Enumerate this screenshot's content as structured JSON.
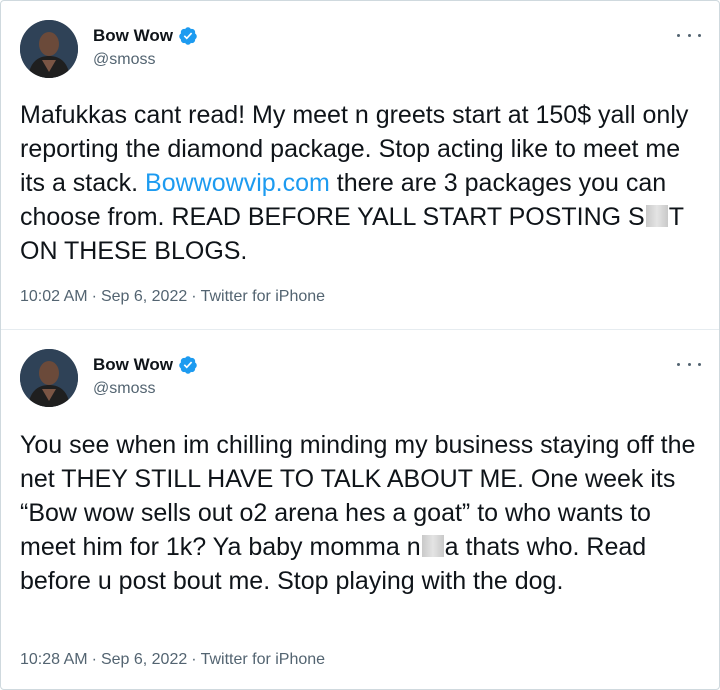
{
  "tweets": [
    {
      "author": {
        "name": "Bow Wow",
        "handle": "@smoss",
        "verified": true
      },
      "text": {
        "part1": "Mafukkas cant read! My meet n greets start at 150$ yall only reporting the diamond package. Stop acting like to meet me its a stack. ",
        "link": "Bowwowvip.com",
        "part2": " there are 3 packages you can choose from. READ BEFORE YALL START POSTING S",
        "part3": "T ON THESE BLOGS."
      },
      "meta": {
        "time": "10:02 AM",
        "date": "Sep 6, 2022",
        "source": "Twitter for iPhone",
        "separator": "·"
      }
    },
    {
      "author": {
        "name": "Bow Wow",
        "handle": "@smoss",
        "verified": true
      },
      "text": {
        "part1": "You see when im chilling minding my business staying off the net THEY STILL HAVE TO TALK ABOUT ME. One week its “Bow wow sells out o2 arena hes a goat” to who wants to meet him for 1k? Ya baby momma n",
        "part2": "a thats who. Read before u post bout me. Stop playing with the dog."
      },
      "meta": {
        "time": "10:28 AM",
        "date": "Sep 6, 2022",
        "source": "Twitter for iPhone",
        "separator": "·"
      }
    }
  ],
  "colors": {
    "link": "#1d9bf0",
    "verified_badge": "#1d9bf0",
    "secondary_text": "#536471"
  },
  "icons": {
    "verified": "verified-badge-icon",
    "more": "more-options-icon"
  }
}
